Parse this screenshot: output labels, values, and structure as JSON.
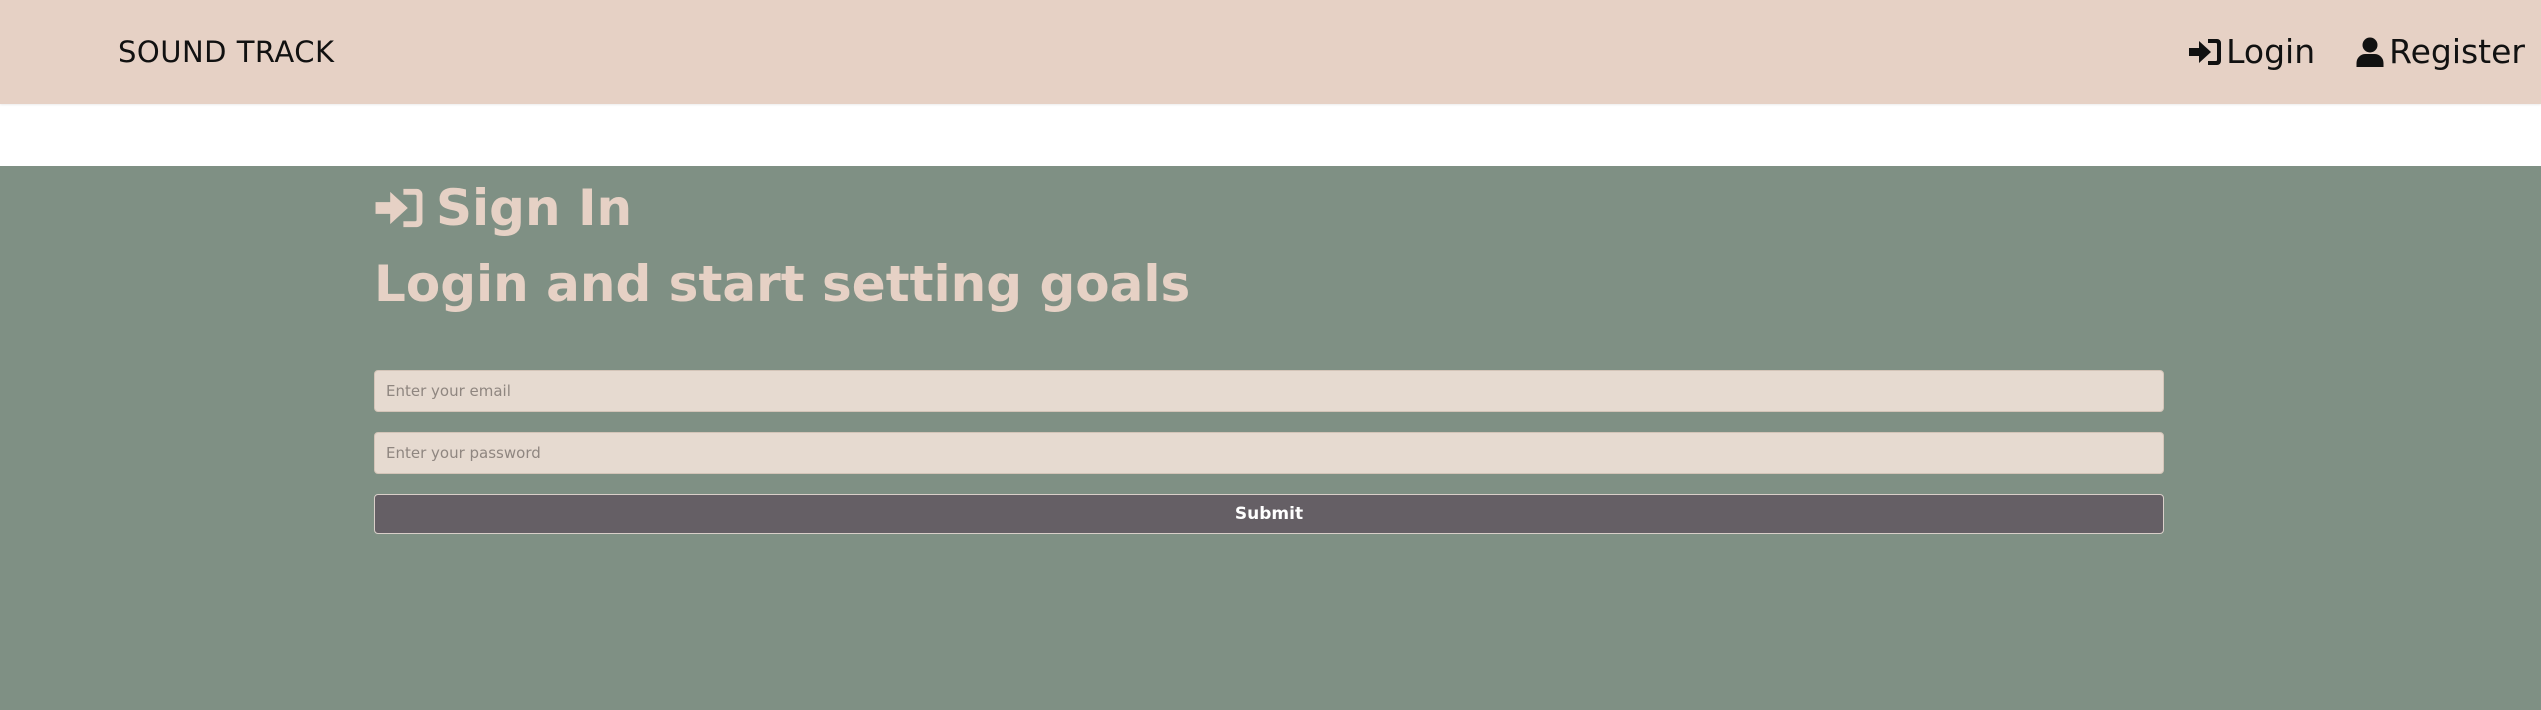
{
  "header": {
    "brand": "SOUND TRACK",
    "nav": [
      {
        "label": "Login",
        "icon": "sign-in-icon"
      },
      {
        "label": "Register",
        "icon": "user-icon"
      }
    ]
  },
  "main": {
    "title": "Sign In",
    "subtitle": "Login and start setting goals",
    "form": {
      "email_placeholder": "Enter your email",
      "password_placeholder": "Enter your password",
      "submit_label": "Submit"
    }
  },
  "colors": {
    "header_bg": "#e6d1c5",
    "main_bg": "#7f9084",
    "text_accent": "#e6d1c5",
    "button_bg": "#655f65",
    "input_bg": "#e6dad0"
  }
}
